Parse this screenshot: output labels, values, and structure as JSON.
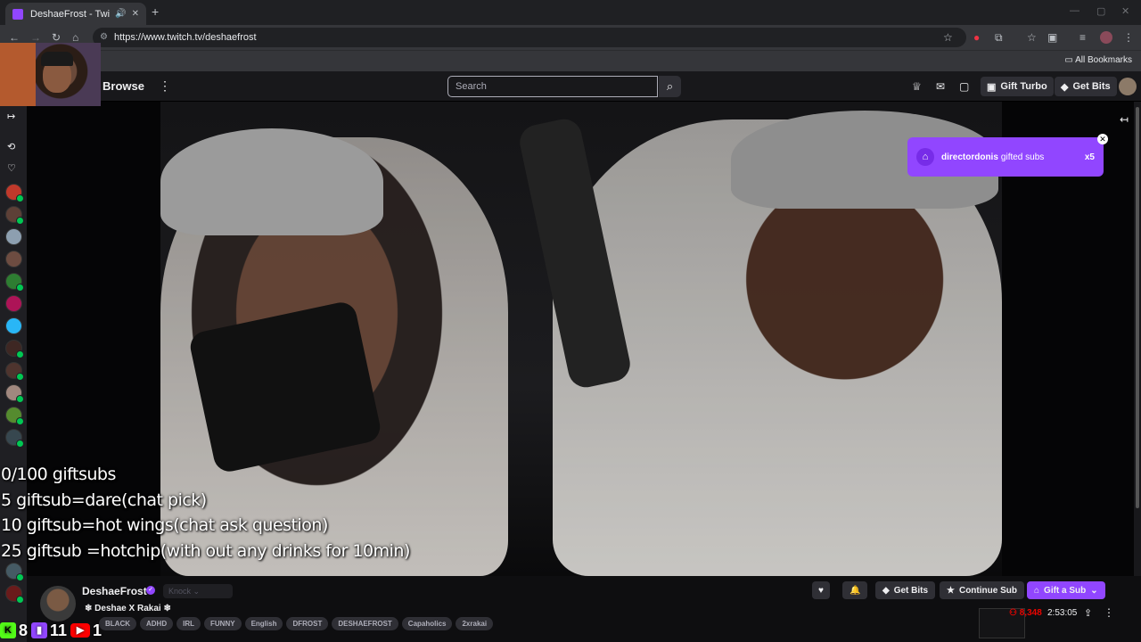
{
  "browser": {
    "tab_title": "DeshaeFrost - Twitch",
    "url": "https://www.twitch.tv/deshaefrost",
    "bookmarks_label": "All Bookmarks",
    "new_tab": "+",
    "tab_close": "✕"
  },
  "topnav": {
    "browse_label": "Browse",
    "search_placeholder": "Search",
    "gift_turbo_label": "Gift Turbo",
    "get_bits_label": "Get Bits"
  },
  "video": {
    "overlay_lines": [
      "0/100 giftsubs",
      "5 giftsub=dare(chat pick)",
      "10 giftsub=hot wings(chat ask question)",
      "25 giftsub =hotchip(with out any drinks for 10min)"
    ]
  },
  "notification": {
    "username": "directordonis",
    "message": "gifted subs",
    "count": "x5"
  },
  "channel": {
    "name": "DeshaeFrost",
    "knock_label": "Knock",
    "stream_title": "Deshae X Rakai",
    "tags": [
      "BLACK",
      "ADHD",
      "IRL",
      "FUNNY",
      "English",
      "DFROST",
      "DESHAEFROST",
      "Capaholics",
      "2xrakai"
    ],
    "viewer_count": "8,348",
    "uptime": "2:53:05"
  },
  "actions": {
    "get_bits_label": "Get Bits",
    "continue_sub_label": "Continue Sub",
    "gift_sub_label": "Gift a Sub"
  },
  "socials": {
    "kick_count": "8",
    "twitch_count": "11",
    "youtube_count": "1"
  },
  "colors": {
    "twitch_purple": "#9146ff",
    "live_red": "#eb0400",
    "kick_green": "#53fc18",
    "youtube_red": "#ff0000"
  }
}
